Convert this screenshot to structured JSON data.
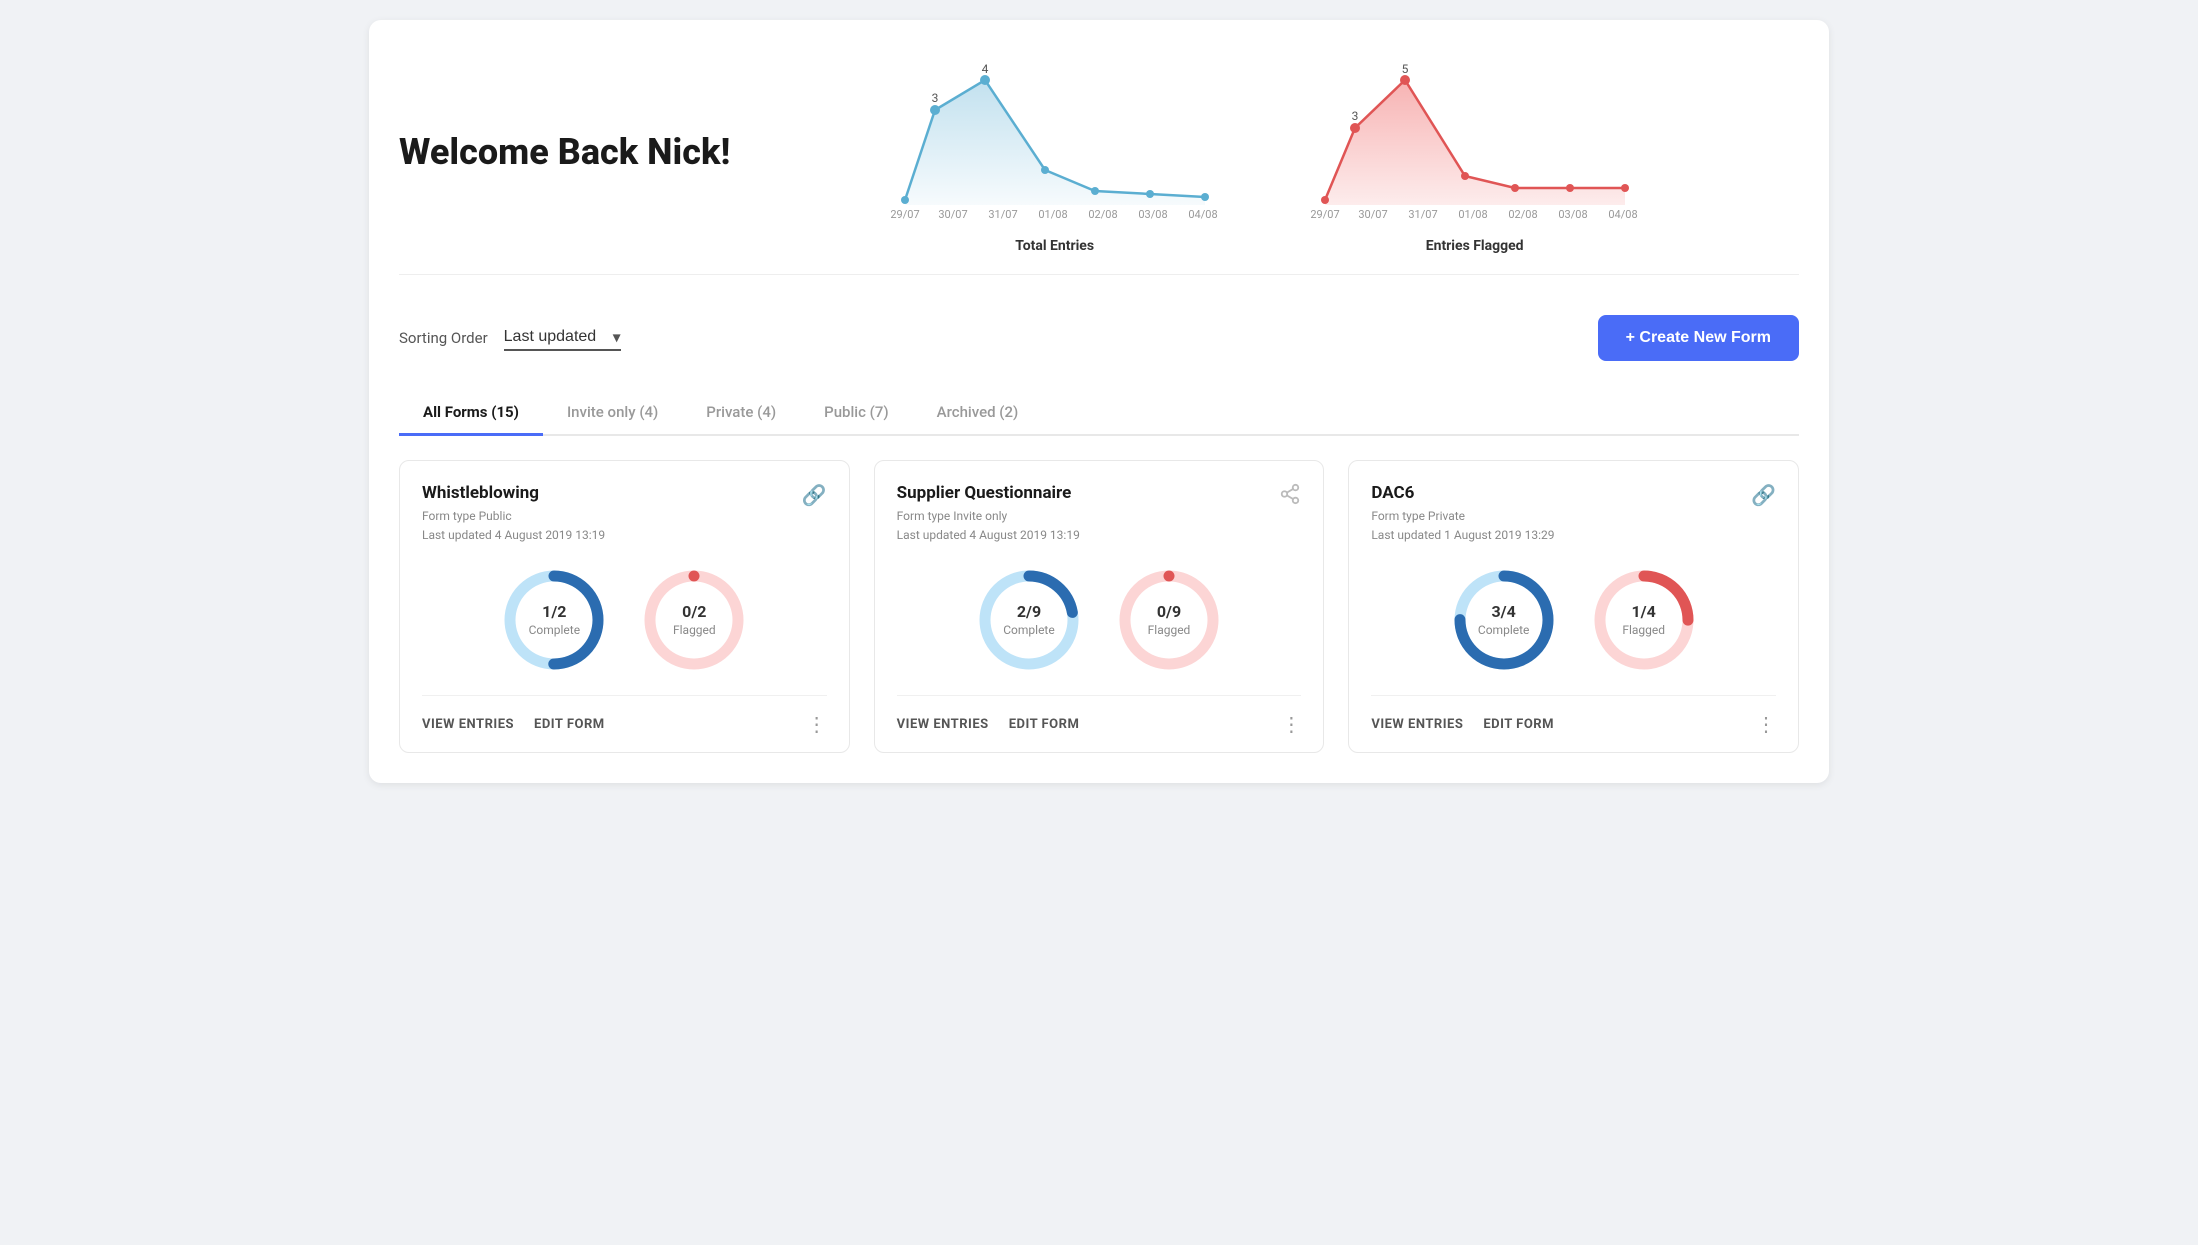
{
  "header": {
    "welcome": "Welcome Back Nick!"
  },
  "charts": {
    "total_entries": {
      "label": "Total Entries",
      "dates": [
        "29/07",
        "30/07",
        "31/07",
        "01/08",
        "02/08",
        "03/08",
        "04/08"
      ],
      "values": [
        0,
        3,
        4,
        1,
        0.3,
        0.2,
        0.1
      ],
      "color": "#a8d4e8",
      "stroke": "#5baed1",
      "point_values": [
        "",
        "3",
        "4",
        "",
        "",
        "",
        ""
      ]
    },
    "entries_flagged": {
      "label": "Entries Flagged",
      "dates": [
        "29/07",
        "30/07",
        "31/07",
        "01/08",
        "02/08",
        "03/08",
        "04/08"
      ],
      "values": [
        0,
        3,
        5,
        1,
        0.5,
        0.5,
        0.5
      ],
      "color": "#f5a0a0",
      "stroke": "#e05555",
      "point_values": [
        "",
        "3",
        "5",
        "",
        "",
        "",
        ""
      ]
    }
  },
  "toolbar": {
    "sort_label": "Sorting Order",
    "sort_value": "Last updated",
    "create_label": "+ Create New Form"
  },
  "tabs": [
    {
      "label": "All Forms (15)",
      "active": true
    },
    {
      "label": "Invite only (4)",
      "active": false
    },
    {
      "label": "Private (4)",
      "active": false
    },
    {
      "label": "Public (7)",
      "active": false
    },
    {
      "label": "Archived (2)",
      "active": false
    }
  ],
  "cards": [
    {
      "title": "Whistleblowing",
      "form_type": "Form type Public",
      "last_updated": "Last updated 4 August 2019 13:19",
      "icon_type": "link",
      "complete_fraction": "1/2",
      "complete_label": "Complete",
      "complete_ratio": 0.5,
      "complete_color_full": "#2b6cb0",
      "complete_color_empty": "#bee3f8",
      "flagged_fraction": "0/2",
      "flagged_label": "Flagged",
      "flagged_ratio": 0,
      "flagged_color_full": "#e05555",
      "flagged_color_empty": "#fcd5d5",
      "view_entries": "VIEW ENTRIES",
      "edit_form": "EDIT FORM"
    },
    {
      "title": "Supplier Questionnaire",
      "form_type": "Form type Invite only",
      "last_updated": "Last updated 4 August 2019 13:19",
      "icon_type": "share",
      "complete_fraction": "2/9",
      "complete_label": "Complete",
      "complete_ratio": 0.222,
      "complete_color_full": "#2b6cb0",
      "complete_color_empty": "#bee3f8",
      "flagged_fraction": "0/9",
      "flagged_label": "Flagged",
      "flagged_ratio": 0,
      "flagged_color_full": "#e05555",
      "flagged_color_empty": "#fcd5d5",
      "view_entries": "VIEW ENTRIES",
      "edit_form": "EDIT FORM"
    },
    {
      "title": "DAC6",
      "form_type": "Form type Private",
      "last_updated": "Last updated 1 August 2019 13:29",
      "icon_type": "link",
      "complete_fraction": "3/4",
      "complete_label": "Complete",
      "complete_ratio": 0.75,
      "complete_color_full": "#2b6cb0",
      "complete_color_empty": "#bee3f8",
      "flagged_fraction": "1/4",
      "flagged_label": "Flagged",
      "flagged_ratio": 0.25,
      "flagged_color_full": "#e05555",
      "flagged_color_empty": "#fcd5d5",
      "view_entries": "VIEW ENTRIES",
      "edit_form": "EDIT FORM"
    }
  ]
}
